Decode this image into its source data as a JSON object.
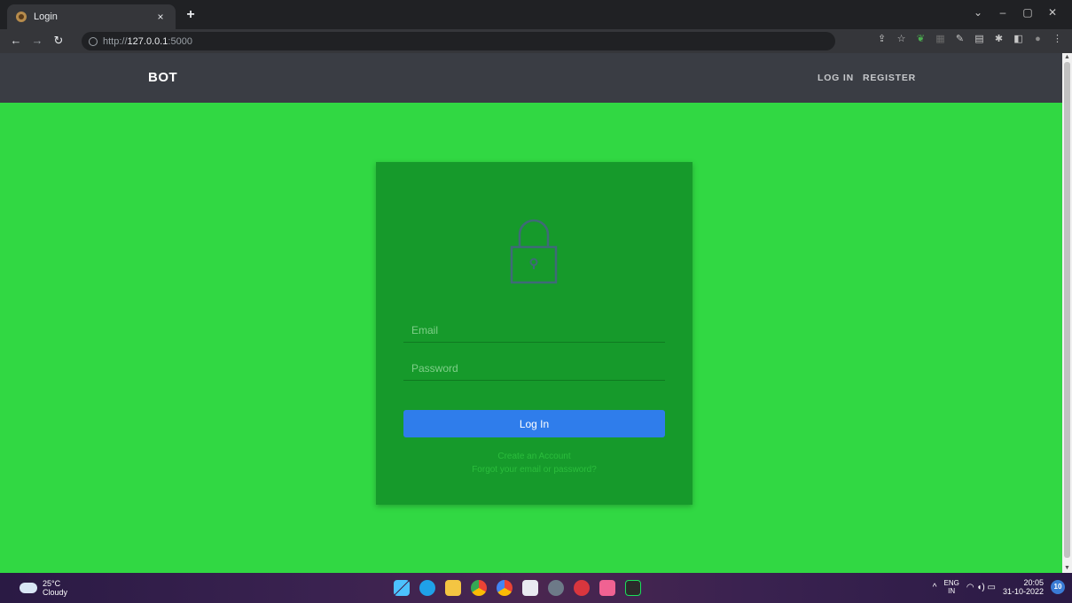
{
  "browser": {
    "tab_title": "Login",
    "tab_close": "×",
    "new_tab": "+",
    "url_scheme": "http://",
    "url_host": "127.0.0.1",
    "url_port": ":5000",
    "window_controls": {
      "collapse": "⌄",
      "minimize": "–",
      "restore": "▢",
      "close": "✕"
    }
  },
  "navbar": {
    "brand": "BOT",
    "links": [
      "LOG IN",
      "REGISTER"
    ]
  },
  "login_form": {
    "email_placeholder": "Email",
    "password_placeholder": "Password",
    "submit_label": "Log In",
    "create_account_link": "Create an Account",
    "forgot_link": "Forgot your email or password?"
  },
  "taskbar": {
    "temperature": "25°C",
    "weather": "Cloudy",
    "lang_primary": "ENG",
    "lang_region": "IN",
    "time": "20:05",
    "date": "31-10-2022",
    "notification_count": "10"
  },
  "colors": {
    "page_background": "#31d843",
    "card_background": "#169a2b",
    "navbar_background": "#3a3d44",
    "button_primary": "#2f7deb"
  }
}
